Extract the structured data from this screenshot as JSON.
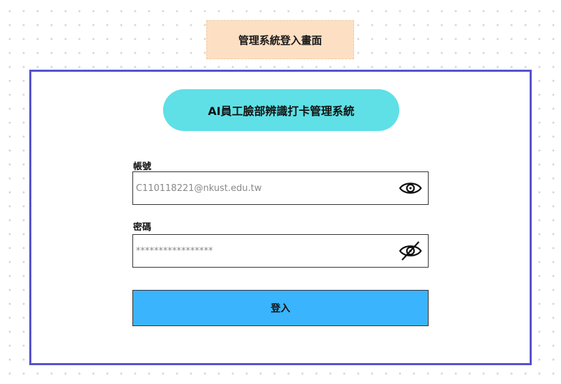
{
  "page_label": "管理系統登入畫面",
  "system_title": "AI員工臉部辨識打卡管理系統",
  "account": {
    "label": "帳號",
    "value": "C110118221@nkust.edu.tw",
    "toggle_icon": "eye-icon"
  },
  "password": {
    "label": "密碼",
    "value": "*****************",
    "toggle_icon": "eye-slash-icon"
  },
  "login_button": "登入",
  "colors": {
    "page_label_bg": "#fde0c4",
    "frame_border": "#5552cc",
    "title_bg": "#5fe0e6",
    "button_bg": "#3ab4fd"
  }
}
